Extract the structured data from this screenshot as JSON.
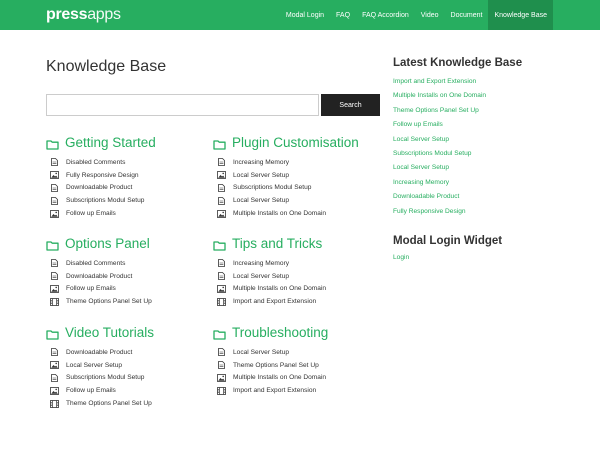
{
  "header": {
    "logo_bold": "press",
    "logo_light": "apps",
    "nav": [
      {
        "label": "Modal Login"
      },
      {
        "label": "FAQ"
      },
      {
        "label": "FAQ Accordion"
      },
      {
        "label": "Video"
      },
      {
        "label": "Document"
      },
      {
        "label": "Knowledge Base",
        "active": true
      }
    ]
  },
  "main": {
    "title": "Knowledge Base",
    "search": {
      "value": "",
      "placeholder": "",
      "button_label": "Search"
    },
    "sections": [
      {
        "title": "Getting Started",
        "items": [
          {
            "label": "Disabled Comments",
            "icon": "document-icon"
          },
          {
            "label": "Fully Responsive Design",
            "icon": "image-icon"
          },
          {
            "label": "Downloadable Product",
            "icon": "document-icon"
          },
          {
            "label": "Subscriptions Modul Setup",
            "icon": "document-icon"
          },
          {
            "label": "Follow up Emails",
            "icon": "image-icon"
          }
        ]
      },
      {
        "title": "Plugin Customisation",
        "items": [
          {
            "label": "Increasing Memory",
            "icon": "document-icon"
          },
          {
            "label": "Local Server Setup",
            "icon": "image-icon"
          },
          {
            "label": "Subscriptions Modul Setup",
            "icon": "document-icon"
          },
          {
            "label": "Local Server Setup",
            "icon": "document-icon"
          },
          {
            "label": "Multiple Installs on One Domain",
            "icon": "image-icon"
          }
        ]
      },
      {
        "title": "Options Panel",
        "items": [
          {
            "label": "Disabled Comments",
            "icon": "document-icon"
          },
          {
            "label": "Downloadable Product",
            "icon": "document-icon"
          },
          {
            "label": "Follow up Emails",
            "icon": "image-icon"
          },
          {
            "label": "Theme Options Panel Set Up",
            "icon": "video-icon"
          }
        ]
      },
      {
        "title": "Tips and Tricks",
        "items": [
          {
            "label": "Increasing Memory",
            "icon": "document-icon"
          },
          {
            "label": "Local Server Setup",
            "icon": "document-icon"
          },
          {
            "label": "Multiple Installs on One Domain",
            "icon": "image-icon"
          },
          {
            "label": "Import and Export Extension",
            "icon": "video-icon"
          }
        ]
      },
      {
        "title": "Video Tutorials",
        "items": [
          {
            "label": "Downloadable Product",
            "icon": "document-icon"
          },
          {
            "label": "Local Server Setup",
            "icon": "image-icon"
          },
          {
            "label": "Subscriptions Modul Setup",
            "icon": "document-icon"
          },
          {
            "label": "Follow up Emails",
            "icon": "image-icon"
          },
          {
            "label": "Theme Options Panel Set Up",
            "icon": "video-icon"
          }
        ]
      },
      {
        "title": "Troubleshooting",
        "items": [
          {
            "label": "Local Server Setup",
            "icon": "document-icon"
          },
          {
            "label": "Theme Options Panel Set Up",
            "icon": "document-icon"
          },
          {
            "label": "Multiple Installs on One Domain",
            "icon": "image-icon"
          },
          {
            "label": "Import and Export Extension",
            "icon": "video-icon"
          }
        ]
      }
    ]
  },
  "sidebar": {
    "latest_title": "Latest Knowledge Base",
    "latest": [
      "Import and Export Extension",
      "Multiple Installs on One Domain",
      "Theme Options Panel Set Up",
      "Follow up Emails",
      "Local Server Setup",
      "Subscriptions Modul Setup",
      "Local Server Setup",
      "Increasing Memory",
      "Downloadable Product",
      "Fully Responsive Design"
    ],
    "login_title": "Modal Login Widget",
    "login_link": "Login"
  },
  "colors": {
    "accent": "#27ae60",
    "nav_active": "#1f8f4d",
    "button": "#222222",
    "text": "#333333"
  }
}
